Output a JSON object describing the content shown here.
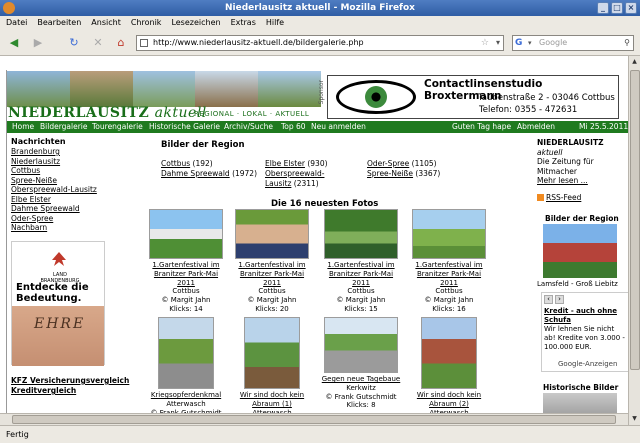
{
  "window": {
    "title": "Niederlausitz aktuell - Mozilla Firefox",
    "minimize": "_",
    "maximize": "□",
    "close": "×"
  },
  "menu": [
    "Datei",
    "Bearbeiten",
    "Ansicht",
    "Chronik",
    "Lesezeichen",
    "Extras",
    "Hilfe"
  ],
  "nav": {
    "url": "http://www.niederlausitz-aktuell.de/bildergalerie.php",
    "search_placeholder": "Google",
    "search_engine_glyph": "G",
    "icons": {
      "back": "◀",
      "forward": "▶",
      "reload": "↻",
      "stop": "✕",
      "home": "⌂",
      "star": "☆",
      "dropdown": "▾",
      "magnifier": "⚲"
    }
  },
  "header": {
    "site_name_main": "NIEDERLAUSITZ",
    "site_name_sub": "aktuell",
    "slogan": "REGIONAL · LOKAL · AKTUELL",
    "sponsor_label": "Sponsor",
    "ad": {
      "name": "Contactlinsenstudio Broxtermann",
      "address": "Taubenstraße 2 - 03046 Cottbus",
      "phone": "Telefon: 0355 - 472631"
    }
  },
  "topnav": {
    "left": [
      "Home",
      "Bildergalerie",
      "Tourengalerie",
      "Historische Galerie",
      "Archiv/Suche",
      "Top 60",
      "Neu anmelden"
    ],
    "greeting": "Guten Tag hape",
    "logout": "Abmelden",
    "date": "Mi 25.5.2011"
  },
  "left": {
    "heading": "Nachrichten",
    "links": [
      "Brandenburg",
      "Niederlausitz",
      "Cottbus",
      "Spree-Neiße",
      "Oberspreewald-Lausitz",
      "Elbe Elster",
      "Dahme Spreewald",
      "Oder-Spree",
      "Nachbarn"
    ],
    "ad_logo_text": "LAND BRANDENBURG",
    "ad_text_1": "Entdecke die",
    "ad_text_2": "Bedeutung.",
    "ad_tattoo": "EHRE",
    "bottom_links": [
      "KFZ Versicherungsvergleich",
      "Kreditvergleich"
    ]
  },
  "center": {
    "heading": "Bilder der Region",
    "regions": [
      {
        "name": "Cottbus",
        "count": "(192)"
      },
      {
        "name": "Dahme Spreewald",
        "count": "(1972)"
      },
      {
        "name": "Elbe Elster",
        "count": "(930)"
      },
      {
        "name": "Oberspreewald-Lausitz",
        "count": "(2311)"
      },
      {
        "name": "Oder-Spree",
        "count": "(1105)"
      },
      {
        "name": "Spree-Neiße",
        "count": "(3367)"
      }
    ],
    "fotos_heading": "Die 16 neuesten Fotos",
    "photos": [
      {
        "title": "1.Gartenfestival im Branitzer Park-Mai 2011",
        "place": "Cottbus",
        "author": "© Margit Jahn",
        "clicks": "Klicks: 14"
      },
      {
        "title": "1.Gartenfestival im Branitzer Park-Mai 2011",
        "place": "Cottbus",
        "author": "© Margit Jahn",
        "clicks": "Klicks: 20"
      },
      {
        "title": "1.Gartenfestival im Branitzer Park-Mai 2011",
        "place": "Cottbus",
        "author": "© Margit Jahn",
        "clicks": "Klicks: 15"
      },
      {
        "title": "1.Gartenfestival im Branitzer Park-Mai 2011",
        "place": "Cottbus",
        "author": "© Margit Jahn",
        "clicks": "Klicks: 16"
      },
      {
        "title": "Kriegsopferdenkmal",
        "place": "Atterwasch",
        "author": "© Frank Gutschmidt",
        "clicks": ""
      },
      {
        "title": "Wir sind doch kein Abraum (1)",
        "place": "Atterwasch",
        "author": "",
        "clicks": ""
      },
      {
        "title": "Gegen neue Tagebaue",
        "place": "Kerkwitz",
        "author": "© Frank Gutschmidt",
        "clicks": "Klicks: 8"
      },
      {
        "title": "Wir sind doch kein Abraum (2)",
        "place": "Atterwasch",
        "author": "",
        "clicks": ""
      }
    ]
  },
  "right": {
    "site_name": "NIEDERLAUSITZ",
    "site_name_sub": "aktuell",
    "tagline_1": "Die Zeitung für",
    "tagline_2": "Mitmacher",
    "more": "Mehr lesen ...",
    "rss": "RSS-Feed",
    "region_heading": "Bilder der Region",
    "region_caption": "Lamsfeld - Groß Liebitz",
    "ad_title": "Kredit - auch ohne Schufa",
    "ad_body": "Wir lehnen Sie nicht ab! Kredite von 3.000 - 100.000 EUR.",
    "ad_footer": "Google-Anzeigen",
    "history_heading": "Historische Bilder"
  },
  "status": {
    "text": "Fertig"
  }
}
